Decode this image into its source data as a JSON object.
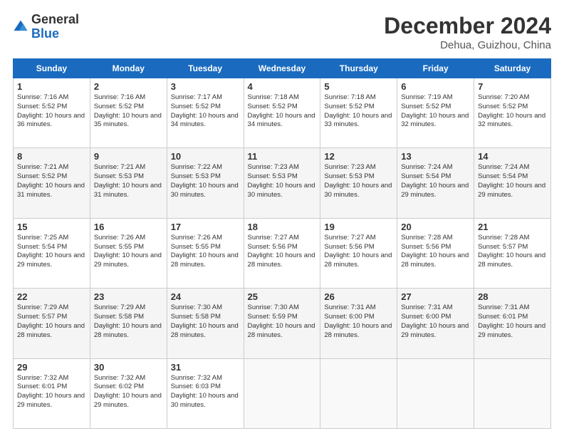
{
  "header": {
    "logo_general": "General",
    "logo_blue": "Blue",
    "main_title": "December 2024",
    "subtitle": "Dehua, Guizhou, China"
  },
  "calendar": {
    "days_of_week": [
      "Sunday",
      "Monday",
      "Tuesday",
      "Wednesday",
      "Thursday",
      "Friday",
      "Saturday"
    ],
    "weeks": [
      [
        null,
        null,
        null,
        null,
        null,
        null,
        null
      ]
    ],
    "cells": [
      {
        "day": "1",
        "sunrise": "7:16 AM",
        "sunset": "5:52 PM",
        "daylight": "10 hours and 36 minutes."
      },
      {
        "day": "2",
        "sunrise": "7:16 AM",
        "sunset": "5:52 PM",
        "daylight": "10 hours and 35 minutes."
      },
      {
        "day": "3",
        "sunrise": "7:17 AM",
        "sunset": "5:52 PM",
        "daylight": "10 hours and 34 minutes."
      },
      {
        "day": "4",
        "sunrise": "7:18 AM",
        "sunset": "5:52 PM",
        "daylight": "10 hours and 34 minutes."
      },
      {
        "day": "5",
        "sunrise": "7:18 AM",
        "sunset": "5:52 PM",
        "daylight": "10 hours and 33 minutes."
      },
      {
        "day": "6",
        "sunrise": "7:19 AM",
        "sunset": "5:52 PM",
        "daylight": "10 hours and 32 minutes."
      },
      {
        "day": "7",
        "sunrise": "7:20 AM",
        "sunset": "5:52 PM",
        "daylight": "10 hours and 32 minutes."
      },
      {
        "day": "8",
        "sunrise": "7:21 AM",
        "sunset": "5:52 PM",
        "daylight": "10 hours and 31 minutes."
      },
      {
        "day": "9",
        "sunrise": "7:21 AM",
        "sunset": "5:53 PM",
        "daylight": "10 hours and 31 minutes."
      },
      {
        "day": "10",
        "sunrise": "7:22 AM",
        "sunset": "5:53 PM",
        "daylight": "10 hours and 30 minutes."
      },
      {
        "day": "11",
        "sunrise": "7:23 AM",
        "sunset": "5:53 PM",
        "daylight": "10 hours and 30 minutes."
      },
      {
        "day": "12",
        "sunrise": "7:23 AM",
        "sunset": "5:53 PM",
        "daylight": "10 hours and 30 minutes."
      },
      {
        "day": "13",
        "sunrise": "7:24 AM",
        "sunset": "5:54 PM",
        "daylight": "10 hours and 29 minutes."
      },
      {
        "day": "14",
        "sunrise": "7:24 AM",
        "sunset": "5:54 PM",
        "daylight": "10 hours and 29 minutes."
      },
      {
        "day": "15",
        "sunrise": "7:25 AM",
        "sunset": "5:54 PM",
        "daylight": "10 hours and 29 minutes."
      },
      {
        "day": "16",
        "sunrise": "7:26 AM",
        "sunset": "5:55 PM",
        "daylight": "10 hours and 29 minutes."
      },
      {
        "day": "17",
        "sunrise": "7:26 AM",
        "sunset": "5:55 PM",
        "daylight": "10 hours and 28 minutes."
      },
      {
        "day": "18",
        "sunrise": "7:27 AM",
        "sunset": "5:56 PM",
        "daylight": "10 hours and 28 minutes."
      },
      {
        "day": "19",
        "sunrise": "7:27 AM",
        "sunset": "5:56 PM",
        "daylight": "10 hours and 28 minutes."
      },
      {
        "day": "20",
        "sunrise": "7:28 AM",
        "sunset": "5:56 PM",
        "daylight": "10 hours and 28 minutes."
      },
      {
        "day": "21",
        "sunrise": "7:28 AM",
        "sunset": "5:57 PM",
        "daylight": "10 hours and 28 minutes."
      },
      {
        "day": "22",
        "sunrise": "7:29 AM",
        "sunset": "5:57 PM",
        "daylight": "10 hours and 28 minutes."
      },
      {
        "day": "23",
        "sunrise": "7:29 AM",
        "sunset": "5:58 PM",
        "daylight": "10 hours and 28 minutes."
      },
      {
        "day": "24",
        "sunrise": "7:30 AM",
        "sunset": "5:58 PM",
        "daylight": "10 hours and 28 minutes."
      },
      {
        "day": "25",
        "sunrise": "7:30 AM",
        "sunset": "5:59 PM",
        "daylight": "10 hours and 28 minutes."
      },
      {
        "day": "26",
        "sunrise": "7:31 AM",
        "sunset": "6:00 PM",
        "daylight": "10 hours and 28 minutes."
      },
      {
        "day": "27",
        "sunrise": "7:31 AM",
        "sunset": "6:00 PM",
        "daylight": "10 hours and 29 minutes."
      },
      {
        "day": "28",
        "sunrise": "7:31 AM",
        "sunset": "6:01 PM",
        "daylight": "10 hours and 29 minutes."
      },
      {
        "day": "29",
        "sunrise": "7:32 AM",
        "sunset": "6:01 PM",
        "daylight": "10 hours and 29 minutes."
      },
      {
        "day": "30",
        "sunrise": "7:32 AM",
        "sunset": "6:02 PM",
        "daylight": "10 hours and 29 minutes."
      },
      {
        "day": "31",
        "sunrise": "7:32 AM",
        "sunset": "6:03 PM",
        "daylight": "10 hours and 30 minutes."
      }
    ]
  }
}
